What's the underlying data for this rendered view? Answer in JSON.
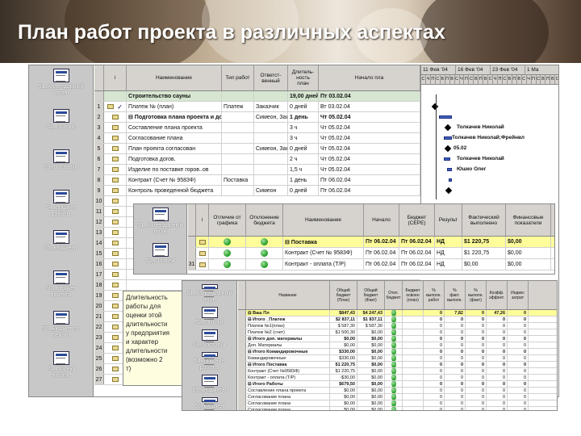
{
  "title": "План работ проекта в различных аспектах",
  "colors": {
    "accent_green": "#1f9a1f",
    "summary_yellow": "#fffd9a",
    "bar_blue": "#4060c0"
  },
  "win1": {
    "views": [
      {
        "label": "51_Календарный\nплан"
      },
      {
        "label": "52_Потоки"
      },
      {
        "label": "53_Поставки"
      },
      {
        "label": "54_Лишние\nработы"
      },
      {
        "label": "55_Бюджеты"
      },
      {
        "label": "56_Бюджет\nпроекта"
      },
      {
        "label": "57_Бюджет по\nПечати"
      },
      {
        "label": "71_Проект\nпечать"
      }
    ],
    "headers": {
      "info": "i",
      "name": "Наименование",
      "type": "Тип работ",
      "resp": "Ответст-\nвенный",
      "dur": "Длитель-\nность план",
      "start": "Начало пла",
      "w1": "11 Фев '04",
      "w2": "16 Фев '04",
      "w3": "23 Фев '04",
      "w4": "1 Ма"
    },
    "days": [
      "С",
      "Ч",
      "П",
      "С",
      "В",
      "П",
      "В",
      "С",
      "Ч",
      "П",
      "С",
      "В",
      "П",
      "В",
      "С",
      "Ч",
      "П",
      "С",
      "В",
      "П",
      "В",
      "С",
      "Ч",
      "П",
      "С",
      "В",
      "П",
      "В",
      "С"
    ],
    "rows": [
      {
        "n": "",
        "name": "Строительство сауны",
        "type": "",
        "resp": "",
        "dur": "19,00 дней",
        "start": "Пт 03.02.04",
        "bold": true
      },
      {
        "n": "1",
        "name": "Платеж № (план)",
        "type": "Платеж",
        "resp": "Заказчик",
        "dur": "0 дней",
        "start": "Вт 03.02.04"
      },
      {
        "n": "2",
        "name": "⊟ Подготовка плана проекта и дог",
        "type": "",
        "resp": "Симеон, Зак",
        "dur": "1 день",
        "start": "Чт 05.02.04",
        "bold": true
      },
      {
        "n": "3",
        "name": "Составление плана проекта",
        "type": "",
        "resp": "",
        "dur": "3 ч",
        "start": "Чт 05.02.04"
      },
      {
        "n": "4",
        "name": "Согласование плана",
        "type": "",
        "resp": "",
        "dur": "3 ч",
        "start": "Чт 05.02.04"
      },
      {
        "n": "5",
        "name": "План проекта согласован",
        "type": "",
        "resp": "Симеон, Зак",
        "dur": "0 дней",
        "start": "Чт 05.02.04"
      },
      {
        "n": "6",
        "name": "Подготовка догов.",
        "type": "",
        "resp": "",
        "dur": "2 ч",
        "start": "Чт 05.02.04"
      },
      {
        "n": "7",
        "name": "Изделие по поставке горов..ов",
        "type": "",
        "resp": "",
        "dur": "1,5 ч",
        "start": "Чт 05.02.04"
      },
      {
        "n": "8",
        "name": "Контракт (Счет № 9583Ф)",
        "type": "Поставка",
        "resp": "",
        "dur": "1 день",
        "start": "Пт 06.02.04"
      },
      {
        "n": "9",
        "name": "Контроль проведенной бюджета",
        "type": "",
        "resp": "Симеон",
        "dur": "0 дней",
        "start": "Пт 06.02.04"
      }
    ],
    "extra_rows": [
      "10",
      "11",
      "12",
      "13",
      "14",
      "15",
      "16",
      "17",
      "18",
      "19",
      "20",
      "21",
      "22",
      "23",
      "24",
      "25",
      "26",
      "27"
    ],
    "gantt_labels": [
      "Толкачев Николай",
      "Толкачев Николай;Фрейнвл",
      "05.02",
      "Толкачев Николай",
      "Юшко Олег"
    ]
  },
  "win2": {
    "views": [
      {
        "label": "51_Календарный\nплан"
      },
      {
        "label": "52_Платеж"
      },
      {
        "label": "53_Оплата"
      }
    ],
    "headers": {
      "info": "i",
      "status": "Отличие от\nграфика",
      "cost": "Отклонение\nбюджета",
      "name": "Наименование",
      "start": "Начало",
      "budget": "Бюджет\n(СЕРЕ)",
      "result": "Результ",
      "act": "Фактический\nвыполнено",
      "fin": "Финансовые\nпоказатели"
    },
    "rows": [
      {
        "n": "",
        "name": "⊟ Поставка",
        "start": "Пт 06.02.04",
        "budget": "Пт 06.02.04",
        "result": "НД",
        "act": "$1 220,75",
        "fin": "$0,00",
        "bold": true,
        "yellow": true
      },
      {
        "n": "",
        "name": "Контракт (Счет № 9583Ф)",
        "start": "Пт 06.02.04",
        "budget": "Пт 06.02.04",
        "result": "НД",
        "act": "$1 220,75",
        "fin": "$0,00"
      },
      {
        "n": "31",
        "name": "Контракт - оплата (Т/Р)",
        "start": "Пт 06.02.04",
        "budget": "Пт 06.02.04",
        "result": "НД",
        "act": "$0,00",
        "fin": "$0,00"
      }
    ]
  },
  "win3": {
    "views": [
      {
        "label": "51_Календарный\nплан"
      },
      {
        "label": "52_Потоки"
      },
      {
        "label": "53_Поставки"
      },
      {
        "label": "54_Лишние\nработы"
      },
      {
        "label": "55_Бюджеты"
      },
      {
        "label": "56_Бюджет\nпроекта"
      }
    ],
    "headers": [
      "Название",
      "Общий\nбюджет\n(План)",
      "Общий\nбюджет\n(Факт)",
      "Откл.\nбюджет",
      "Бюджет\nосвоен\n(план)",
      "%\nвыполн.\nработ",
      "%\nфакт.\nвыполн.",
      "%\nвыполн.\n(факт)",
      "Коэфф.\nэффект.",
      "Индекс\nзатрат"
    ],
    "rows": [
      {
        "name": "⊟ Ваш Пл",
        "v": [
          "$847,43",
          "$4 247,43",
          "",
          "",
          "0",
          "7,82",
          "0",
          "47,26",
          "0"
        ],
        "bold": true,
        "yellow": true
      },
      {
        "name": "⊟ Итого _Платеж",
        "v": [
          "$2 837,11",
          "$1 837,11",
          "",
          "",
          "0",
          "0",
          "0",
          "0",
          "0"
        ],
        "bold": true
      },
      {
        "name": "Платеж №1(план)",
        "v": [
          "$ 587,30",
          "$ 587,30",
          "",
          "",
          "0",
          "0",
          "0",
          "0",
          "0"
        ]
      },
      {
        "name": "Платеж №2 (счет)",
        "v": [
          "$1 500,30",
          "$0,00",
          "",
          "",
          "0",
          "0",
          "0",
          "0",
          "0"
        ]
      },
      {
        "name": "⊟ Итого доп. материалы",
        "v": [
          "$0,00",
          "$0,00",
          "",
          "",
          "0",
          "0",
          "0",
          "0",
          "0"
        ],
        "bold": true
      },
      {
        "name": "Доп. Материалы",
        "v": [
          "$0,00",
          "$0,00",
          "",
          "",
          "0",
          "0",
          "0",
          "0",
          "0"
        ]
      },
      {
        "name": "⊟ Итого Командировочные",
        "v": [
          "$330,00",
          "$0,00",
          "",
          "",
          "0",
          "0",
          "0",
          "0",
          "0"
        ],
        "bold": true
      },
      {
        "name": "Командировочные",
        "v": [
          "$330,00",
          "$0,00",
          "",
          "",
          "0",
          "0",
          "0",
          "0",
          "0"
        ]
      },
      {
        "name": "⊟ Итого Поставка",
        "v": [
          "$1 220,75",
          "$0,00",
          "",
          "",
          "0",
          "0",
          "0",
          "0",
          "0"
        ],
        "bold": true
      },
      {
        "name": "Контракт (Счет №9583Ф)",
        "v": [
          "$1 220,75",
          "$0,00",
          "",
          "",
          "0",
          "0",
          "0",
          "0",
          "0"
        ]
      },
      {
        "name": "Контракт - оплата (Т/Р)",
        "v": [
          "-$30,00",
          "$0,00",
          "",
          "",
          "0",
          "0",
          "0",
          "0",
          "0"
        ]
      },
      {
        "name": "⊟ Итого Работы",
        "v": [
          "$679,50",
          "$0,00",
          "",
          "",
          "0",
          "0",
          "0",
          "0",
          "0"
        ],
        "bold": true
      },
      {
        "name": "Составление плана проекта",
        "v": [
          "$0,00",
          "$0,00",
          "",
          "",
          "0",
          "0",
          "0",
          "0",
          "0"
        ]
      },
      {
        "name": "Согласование плана",
        "v": [
          "$0,00",
          "$0,00",
          "",
          "",
          "0",
          "0",
          "0",
          "0",
          "0"
        ]
      },
      {
        "name": "Согласование плана",
        "v": [
          "$0,00",
          "$0,00",
          "",
          "",
          "0",
          "0",
          "0",
          "0",
          "0"
        ]
      },
      {
        "name": "Согласование плана",
        "v": [
          "$0,00",
          "$0,00",
          "",
          "",
          "0",
          "0",
          "0",
          "0",
          "0"
        ]
      }
    ]
  },
  "note": {
    "text": "Длительность\nработы для\nоценки этой\nдлительности\nу предприятия\nи характер\nдлительности\n(возможно 2\nт)"
  }
}
